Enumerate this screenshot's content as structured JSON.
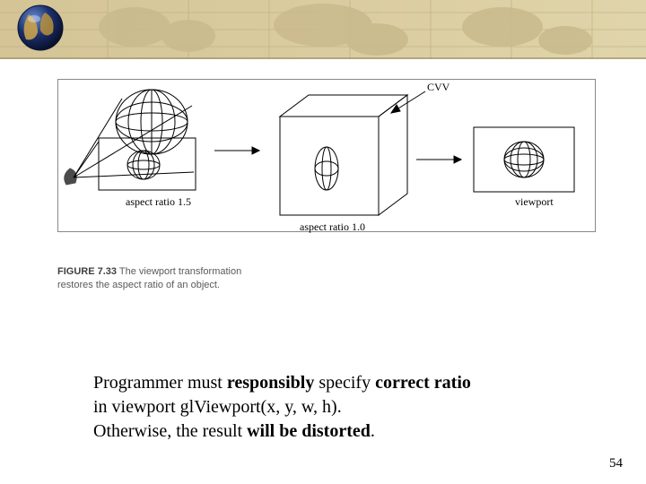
{
  "figure": {
    "cvv_label": "CVV",
    "aspect_15": "aspect ratio 1.5",
    "aspect_10": "aspect ratio 1.0",
    "viewport_label": "viewport",
    "caption_tag": "FIGURE 7.33",
    "caption_text": " The viewport transformation restores the aspect ratio of an object."
  },
  "body": {
    "line1_a": "Programmer must ",
    "line1_b": "responsibly",
    "line1_c": " specify ",
    "line1_d": "correct ratio",
    "line2": "in viewport glViewport(x, y, w, h).",
    "line3_a": "Otherwise, the result ",
    "line3_b": "will be distorted",
    "line3_c": "."
  },
  "page_number": "54"
}
